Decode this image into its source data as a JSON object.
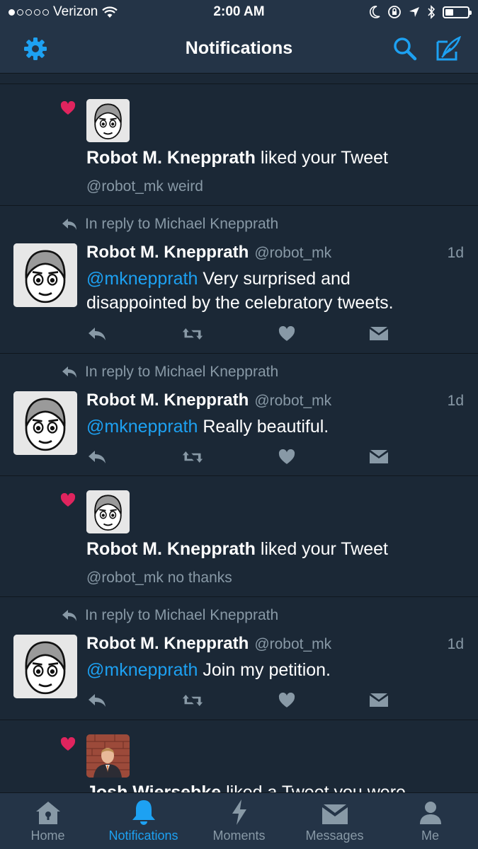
{
  "status": {
    "carrier": "Verizon",
    "time": "2:00 AM"
  },
  "header": {
    "title": "Notifications"
  },
  "notifications": [
    {
      "type": "like",
      "name": "Robot M. Knepprath",
      "action": "liked your Tweet",
      "sub": "@robot_mk weird"
    },
    {
      "type": "reply",
      "context": "In reply to Michael Knepprath",
      "name": "Robot M. Knepprath",
      "handle": "@robot_mk",
      "time": "1d",
      "mention": "@mknepprath",
      "text": "Very surprised and disappointed by the celebratory tweets."
    },
    {
      "type": "reply",
      "context": "In reply to Michael Knepprath",
      "name": "Robot M. Knepprath",
      "handle": "@robot_mk",
      "time": "1d",
      "mention": "@mknepprath",
      "text": "Really beautiful."
    },
    {
      "type": "like",
      "name": "Robot M. Knepprath",
      "action": "liked your Tweet",
      "sub": "@robot_mk no thanks"
    },
    {
      "type": "reply",
      "context": "In reply to Michael Knepprath",
      "name": "Robot M. Knepprath",
      "handle": "@robot_mk",
      "time": "1d",
      "mention": "@mknepprath",
      "text": "Join my petition."
    },
    {
      "type": "like",
      "name": "Josh Wiersebke",
      "action": "liked a Tweet you were"
    }
  ],
  "tabs": [
    {
      "label": "Home",
      "icon": "home-icon"
    },
    {
      "label": "Notifications",
      "icon": "bell-icon",
      "active": true
    },
    {
      "label": "Moments",
      "icon": "lightning-icon"
    },
    {
      "label": "Messages",
      "icon": "envelope-icon"
    },
    {
      "label": "Me",
      "icon": "person-icon"
    }
  ],
  "colors": {
    "background": "#1b2836",
    "bar": "#243447",
    "accent": "#1da1f2",
    "muted": "#8899a6",
    "heart": "#e0245e"
  }
}
